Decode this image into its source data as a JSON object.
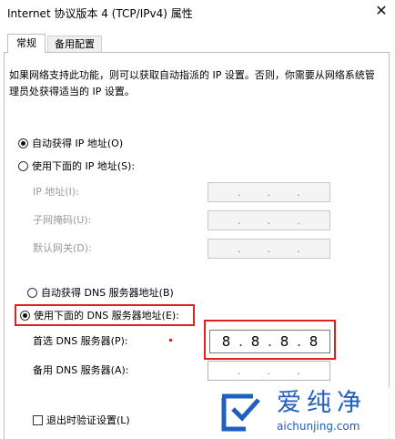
{
  "window": {
    "title": "Internet 协议版本 4 (TCP/IPv4) 属性",
    "close_glyph": "✕"
  },
  "tabs": [
    {
      "label": "常规",
      "active": true
    },
    {
      "label": "备用配置",
      "active": false
    }
  ],
  "description": "如果网络支持此功能，则可以获取自动指派的 IP 设置。否则，你需要从网络系统管理员处获得适当的 IP 设置。",
  "ip_mode": {
    "auto_label": "自动获得 IP 地址(O)",
    "manual_label": "使用下面的 IP 地址(S):",
    "selected": "auto"
  },
  "ip_fields": {
    "ip_label": "IP 地址(I):",
    "mask_label": "子网掩码(U):",
    "gateway_label": "默认网关(D):",
    "dot": "."
  },
  "dns_mode": {
    "auto_label": "自动获得 DNS 服务器地址(B)",
    "manual_label": "使用下面的 DNS 服务器地址(E):",
    "selected": "manual"
  },
  "dns_fields": {
    "preferred_label": "首选 DNS 服务器(P):",
    "preferred_value": [
      "8",
      "8",
      "8",
      "8"
    ],
    "alternate_label": "备用 DNS 服务器(A):",
    "dot": "."
  },
  "validate_on_exit": {
    "label": "退出时验证设置(L)",
    "checked": false
  },
  "watermark": {
    "brand": "爱纯净",
    "url": "aichunjing.com"
  },
  "colors": {
    "highlight": "#e0211f",
    "watermark_blue": "#1f5fbf"
  }
}
